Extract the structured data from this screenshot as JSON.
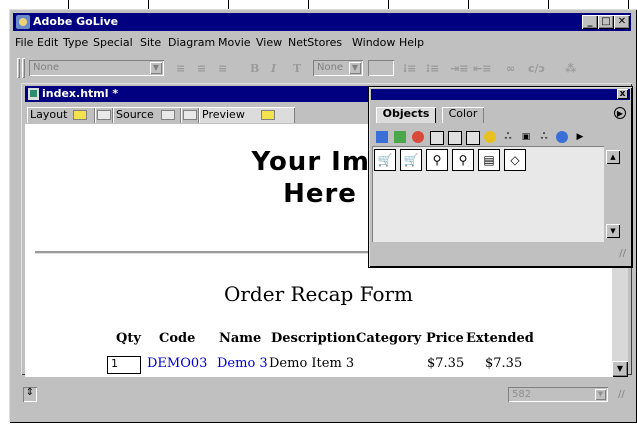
{
  "app": {
    "title": "Adobe GoLive",
    "window_buttons": [
      "_",
      "□",
      "✕"
    ]
  },
  "menu": [
    "File",
    "Edit",
    "Type",
    "Special",
    "Site",
    "Diagram",
    "Movie",
    "View",
    "NetStores",
    "Window",
    "Help"
  ],
  "toolbar": {
    "paragraph_format": "None",
    "font_size": "None"
  },
  "document": {
    "title": "index.html *",
    "tabs": [
      "Layout",
      "Source",
      "Preview"
    ]
  },
  "page": {
    "banner_line1": "Your Ima",
    "banner_line2": "Here",
    "form_title": "Order Recap Form",
    "columns": [
      "Qty",
      "Code",
      "Name",
      "Description",
      "Category",
      "Price",
      "Extended"
    ],
    "row": {
      "qty": "1",
      "code": "DEMO03",
      "name": "Demo 3",
      "description": "Demo Item 3",
      "price": "$7.35",
      "extended": "$7.35"
    }
  },
  "status": {
    "width_value": "582"
  },
  "palette": {
    "tabs": [
      "Objects",
      "Color"
    ],
    "close": "x"
  }
}
